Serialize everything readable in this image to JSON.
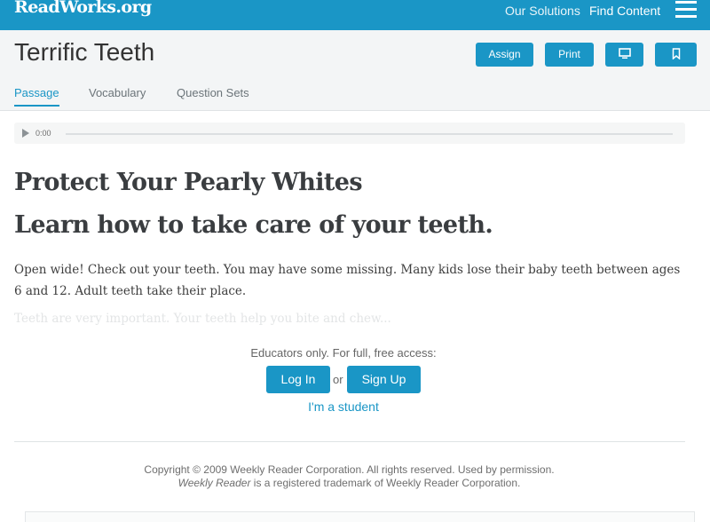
{
  "header": {
    "logo": "ReadWorks.org",
    "nav": [
      "Our Solutions",
      "Find Content"
    ],
    "menu_icon": "hamburger-menu-icon"
  },
  "article": {
    "title": "Terrific Teeth",
    "actions": {
      "assign": "Assign",
      "print": "Print",
      "present_icon": "monitor-icon",
      "save_icon": "bookmark-icon"
    },
    "tabs": [
      "Passage",
      "Vocabulary",
      "Question Sets"
    ],
    "active_tab": "Passage"
  },
  "audio": {
    "time": "0:00",
    "play_icon": "play-icon"
  },
  "passage": {
    "heading": "Protect Your Pearly Whites",
    "subheading": "Learn how to take care of your teeth.",
    "paragraph": "Open wide! Check out your teeth. You may have some missing. Many kids lose their baby teeth between ages 6 and 12. Adult teeth take their place.",
    "faded_preview": "Teeth are very important. Your teeth help you bite and chew..."
  },
  "access": {
    "note": "Educators only. For full, free access:",
    "login": "Log In",
    "or": "or",
    "signup": "Sign Up",
    "student": "I'm a student"
  },
  "footer": {
    "copyright": "Copyright © 2009 Weekly Reader Corporation. All rights reserved. Used by permission.",
    "trademark_brand": "Weekly Reader",
    "trademark_rest": " is a registered trademark of Weekly Reader Corporation."
  },
  "colors": {
    "brand": "#1a96c6",
    "title_area_bg": "#f3f5f6",
    "text": "#3a3d40"
  }
}
